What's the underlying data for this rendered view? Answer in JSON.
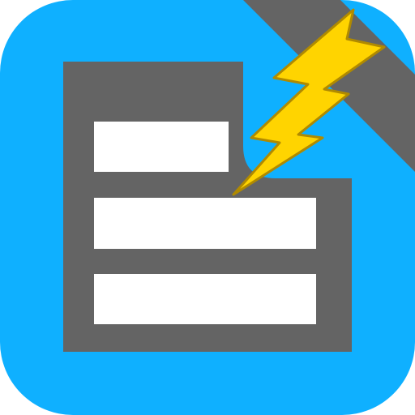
{
  "icon": {
    "name": "form-lightning-app-icon",
    "background_color": "#0FB0FF",
    "corner_band_color": "#646464",
    "document_color": "#646464",
    "field_color": "#FFFFFF",
    "bolt_color": "#FFD400",
    "bolt_outline_color": "#B08A00",
    "field_count": 3,
    "icons": [
      "document-icon",
      "lightning-bolt-icon"
    ]
  }
}
